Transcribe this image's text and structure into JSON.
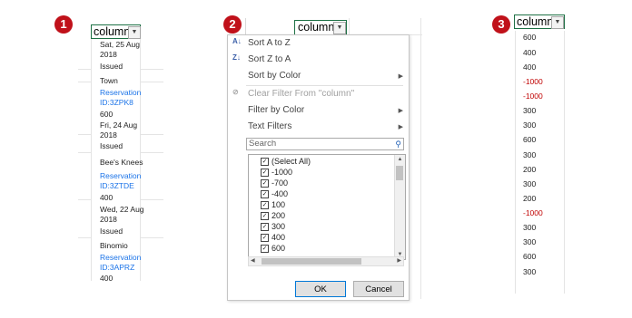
{
  "panel1": {
    "badge": "1",
    "header": "column",
    "rows": [
      {
        "text": "Sat, 25 Aug",
        "color": "#222222"
      },
      {
        "text": "2018",
        "color": "#222222"
      },
      {
        "text": "Issued",
        "color": "#222222"
      },
      {
        "text": "Town",
        "color": "#222222"
      },
      {
        "text": "Reservation",
        "color": "#1a73e8"
      },
      {
        "text": "ID:3ZPK8",
        "color": "#1a73e8"
      },
      {
        "text": "600",
        "color": "#222222"
      },
      {
        "text": "Fri, 24 Aug",
        "color": "#222222"
      },
      {
        "text": "2018",
        "color": "#222222"
      },
      {
        "text": "Issued",
        "color": "#222222"
      },
      {
        "text": "Bee's Knees",
        "color": "#222222"
      },
      {
        "text": "Reservation",
        "color": "#1a73e8"
      },
      {
        "text": "ID:3ZTDE",
        "color": "#1a73e8"
      },
      {
        "text": "400",
        "color": "#222222"
      },
      {
        "text": "Wed, 22 Aug",
        "color": "#222222"
      },
      {
        "text": "2018",
        "color": "#222222"
      },
      {
        "text": "Issued",
        "color": "#222222"
      },
      {
        "text": "Binomio",
        "color": "#222222"
      },
      {
        "text": "Reservation",
        "color": "#1a73e8"
      },
      {
        "text": "ID:3APRZ",
        "color": "#1a73e8"
      },
      {
        "text": "400",
        "color": "#222222"
      }
    ]
  },
  "panel2": {
    "badge": "2",
    "header": "column",
    "menu": {
      "sort_az": "Sort A to Z",
      "sort_za": "Sort Z to A",
      "sort_color": "Sort by Color",
      "clear_filter": "Clear Filter From \"column\"",
      "filter_color": "Filter by Color",
      "text_filters": "Text Filters",
      "search_placeholder": "Search",
      "list_items": [
        "(Select All)",
        "-1000",
        "-700",
        "-400",
        "100",
        "200",
        "300",
        "400",
        "600"
      ],
      "ok": "OK",
      "cancel": "Cancel"
    }
  },
  "panel3": {
    "badge": "3",
    "header": "column",
    "values": [
      {
        "text": "600",
        "negative": false
      },
      {
        "text": "400",
        "negative": false
      },
      {
        "text": "400",
        "negative": false
      },
      {
        "text": "-1000",
        "negative": true
      },
      {
        "text": "-1000",
        "negative": true
      },
      {
        "text": "300",
        "negative": false
      },
      {
        "text": "300",
        "negative": false
      },
      {
        "text": "600",
        "negative": false
      },
      {
        "text": "300",
        "negative": false
      },
      {
        "text": "200",
        "negative": false
      },
      {
        "text": "300",
        "negative": false
      },
      {
        "text": "200",
        "negative": false
      },
      {
        "text": "-1000",
        "negative": true
      },
      {
        "text": "300",
        "negative": false
      },
      {
        "text": "300",
        "negative": false
      },
      {
        "text": "600",
        "negative": false
      },
      {
        "text": "300",
        "negative": false
      }
    ]
  },
  "colors": {
    "badge": "#c0111a",
    "negative": "#c00000",
    "link": "#1a73e8",
    "header_border": "#1e7145"
  }
}
